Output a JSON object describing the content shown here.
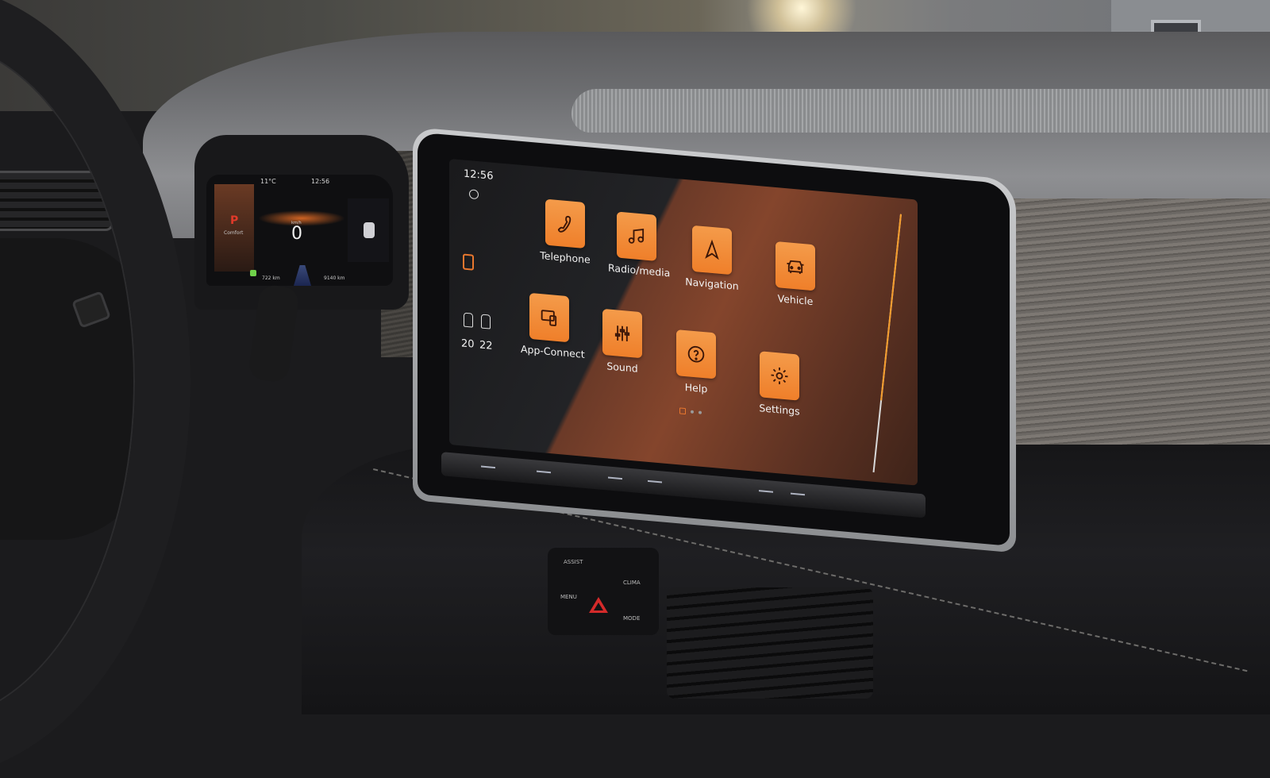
{
  "scene": {
    "description": "Car interior dashboard photo with infotainment touchscreen"
  },
  "cluster": {
    "temperature": "11°C",
    "time": "12:56",
    "gear": "P",
    "drive_mode": "Comfort",
    "speed": "0",
    "speed_unit": "km/h",
    "range": "722 km",
    "odometer": "9140 km",
    "colors": {
      "gear": "#e03a2a",
      "status_ok": "#6fd14a"
    }
  },
  "infotainment": {
    "status_bar": {
      "time": "12:56",
      "globe_icon": "globe-icon"
    },
    "sidebar": {
      "home_icon": "home-icon",
      "climate": {
        "driver_temp": "20",
        "passenger_temp": "22"
      }
    },
    "apps": [
      {
        "id": "telephone",
        "label": "Telephone",
        "icon": "phone-icon"
      },
      {
        "id": "radio-media",
        "label": "Radio/media",
        "icon": "music-note-icon"
      },
      {
        "id": "navigation",
        "label": "Navigation",
        "icon": "navigation-arrow-icon"
      },
      {
        "id": "vehicle",
        "label": "Vehicle",
        "icon": "car-icon"
      },
      {
        "id": "app-connect",
        "label": "App-Connect",
        "icon": "phone-tablet-icon"
      },
      {
        "id": "sound",
        "label": "Sound",
        "icon": "equalizer-icon"
      },
      {
        "id": "help",
        "label": "Help",
        "icon": "question-circle-icon"
      },
      {
        "id": "settings",
        "label": "Settings",
        "icon": "gear-icon"
      }
    ],
    "pagination": {
      "current": 1,
      "total": 3
    },
    "volume_slider": {
      "level_percent": 72
    },
    "colors": {
      "accent": "#ef7f2a",
      "tile_top": "#f49b4a",
      "text": "#f2f2f2"
    }
  },
  "console": {
    "buttons": [
      {
        "id": "assist",
        "label": "ASSIST"
      },
      {
        "id": "clima",
        "label": "CLIMA"
      },
      {
        "id": "menu",
        "label": "MENU"
      },
      {
        "id": "mode",
        "label": "MODE"
      },
      {
        "id": "hazard",
        "label": ""
      }
    ]
  }
}
